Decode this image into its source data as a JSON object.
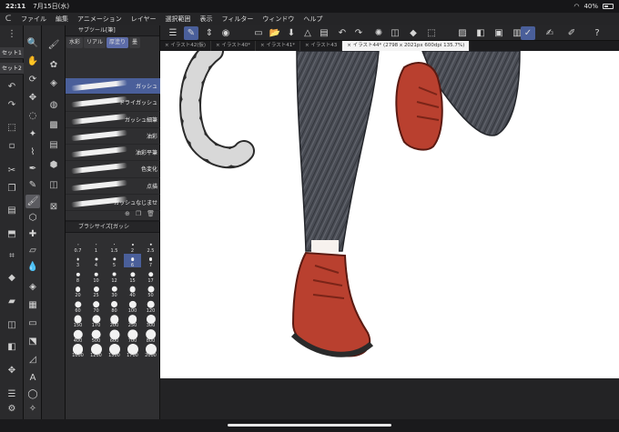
{
  "status": {
    "time": "22:11",
    "date": "7月15日(水)",
    "battery": "40%"
  },
  "menu": {
    "logo": "logo-icon",
    "items": [
      "ファイル",
      "編集",
      "アニメーション",
      "レイヤー",
      "選択範囲",
      "表示",
      "フィルター",
      "ウィンドウ",
      "ヘルプ"
    ]
  },
  "sets": [
    "セット1",
    "セット2"
  ],
  "subtool": {
    "header": "サブツール[筆]",
    "tabs": [
      "水彩",
      "リアル",
      "厚塗り",
      "墨"
    ],
    "active_tab": "厚塗り",
    "brushes": [
      "ガッシュ",
      "ドライガッシュ",
      "ガッシュ細筆",
      "油彩",
      "油彩平筆",
      "色変化",
      "点描",
      "ガッシュなじませ"
    ],
    "selected_brush": "ガッシュ"
  },
  "brush_size": {
    "header": "ブラシサイズ[ガッシ",
    "sizes": [
      "0.7",
      "1",
      "1.5",
      "2",
      "2.5",
      "3",
      "4",
      "5",
      "6",
      "7",
      "8",
      "10",
      "12",
      "15",
      "17",
      "20",
      "25",
      "30",
      "40",
      "50",
      "60",
      "70",
      "80",
      "100",
      "120",
      "150",
      "170",
      "200",
      "250",
      "300",
      "400",
      "500",
      "600",
      "700",
      "800",
      "1000",
      "1200",
      "1500",
      "1700",
      "2000"
    ],
    "selected": "6"
  },
  "tabs": [
    "イラスト42(仮)",
    "イラスト40*",
    "イラスト41*",
    "イラスト43",
    "イラスト44* (2798 x 2021px 600dpi 135.7%)"
  ],
  "active_tab_index": 4,
  "colors": {
    "accent": "#4a5f9a",
    "boot": "#b9402f",
    "jeans": "#4a4d55",
    "background": "#1e1e20"
  }
}
